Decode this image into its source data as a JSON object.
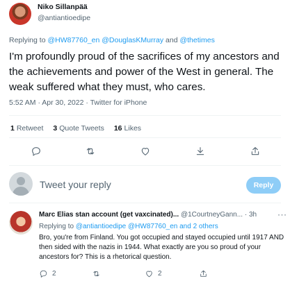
{
  "tweet": {
    "author_name": "Niko Sillanpää",
    "author_handle": "@antiantioedipe",
    "replying_prefix": "Replying to",
    "replying_handles": [
      "@HW87760_en",
      "@DouglasKMurray",
      "@thetimes"
    ],
    "replying_and": "and",
    "text": "I'm profoundly proud of the sacrifices of my ancestors and the achievements and power of the West in general. The weak suffered what they must, who cares.",
    "time": "5:52 AM",
    "date": "Apr 30, 2022",
    "source": "Twitter for iPhone",
    "meta_sep": " · "
  },
  "stats": {
    "retweets_count": "1",
    "retweets_label": "Retweet",
    "quotes_count": "3",
    "quotes_label": "Quote Tweets",
    "likes_count": "16",
    "likes_label": "Likes"
  },
  "actions": {
    "icons": [
      "reply-icon",
      "retweet-icon",
      "like-icon",
      "bookmark-icon",
      "share-icon"
    ]
  },
  "compose": {
    "placeholder": "Tweet your reply",
    "reply_button": "Reply"
  },
  "reply": {
    "author_name": "Marc Elias stan account (get vaxcinated)...",
    "author_handle": "@1CourtneyGann...",
    "time": "3h",
    "more": "···",
    "replying_prefix": "Replying to",
    "replying_handles": [
      "@antiantioedipe",
      "@HW87760_en"
    ],
    "replying_others": "and 2 others",
    "text": "Bro, you're from Finland. You got occupied and stayed occupied until 1917 AND then sided with the nazis in 1944. What exactly are you so proud of your ancestors for? This is a rhetorical question.",
    "reply_count": "2",
    "retweet_count": "",
    "like_count": "2"
  },
  "colors": {
    "accent": "#1d9bf0",
    "text_primary": "#0f1419",
    "text_secondary": "#536471",
    "reply_button_disabled": "#8ecdf7"
  }
}
